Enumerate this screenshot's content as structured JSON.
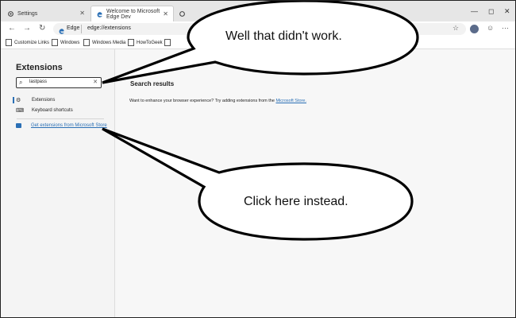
{
  "tabs": [
    {
      "label": "Settings",
      "icon": "gear-icon"
    },
    {
      "label": "Welcome to Microsoft Edge Dev",
      "icon": "edge-icon"
    },
    {
      "label": "",
      "icon": "gear-icon"
    }
  ],
  "address": {
    "site_label": "Edge",
    "url": "edge://extensions"
  },
  "favorites": [
    {
      "label": "Customize Links"
    },
    {
      "label": "Windows"
    },
    {
      "label": "Windows Media"
    },
    {
      "label": "HowToGeek"
    }
  ],
  "sidebar": {
    "title": "Extensions",
    "search_value": "lastpass",
    "items": [
      {
        "label": "Extensions",
        "icon": "extensions-icon"
      },
      {
        "label": "Keyboard shortcuts",
        "icon": "keyboard-icon"
      }
    ],
    "store_link": "Get extensions from Microsoft Store"
  },
  "main": {
    "title": "Search results",
    "message": "Want to enhance your browser experience? Try adding extensions from the",
    "link": "Microsoft Store.",
    "period": ""
  },
  "callouts": [
    {
      "text": "Well that didn't work."
    },
    {
      "text": "Click here instead."
    }
  ],
  "colors": {
    "accent": "#2a6fb5",
    "page_bg": "#f7f7f7"
  }
}
